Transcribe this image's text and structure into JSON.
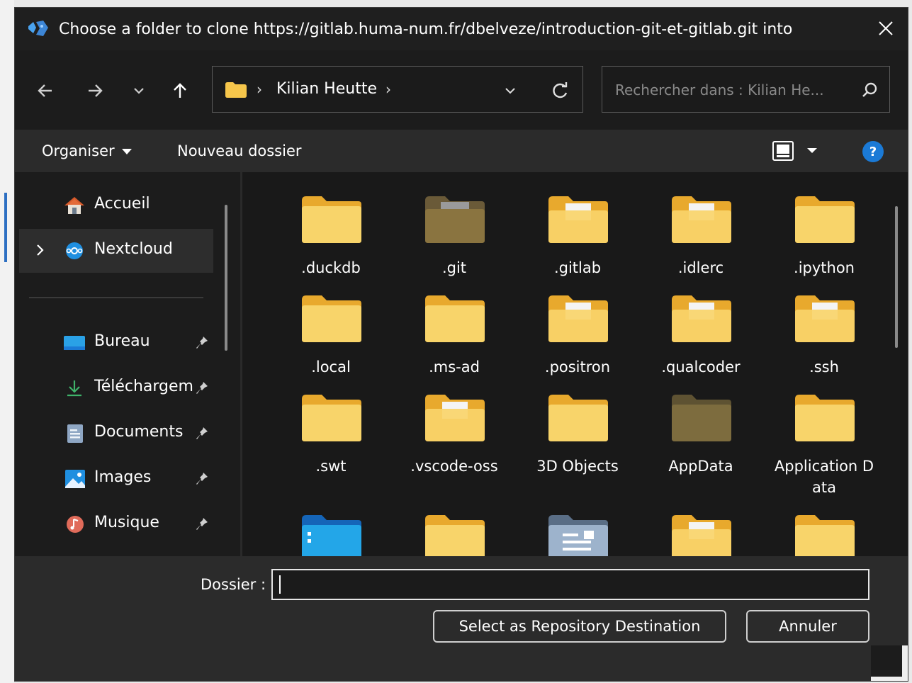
{
  "window": {
    "title": "Choose a folder to clone https://gitlab.huma-num.fr/dbelveze/introduction-git-et-gitlab.git into",
    "app_icon": "vscodium-logo-icon",
    "close_icon": "close-icon"
  },
  "nav": {
    "back_icon": "arrow-left-icon",
    "forward_icon": "arrow-right-icon",
    "recent_icon": "chevron-down-icon",
    "up_icon": "arrow-up-icon",
    "breadcrumb": [
      "Kilian Heutte"
    ],
    "refresh_icon": "refresh-icon",
    "search_placeholder": "Rechercher dans : Kilian He..."
  },
  "toolbar": {
    "organize_label": "Organiser",
    "new_folder_label": "Nouveau dossier",
    "view_icon": "view-mode-icon",
    "help_label": "?"
  },
  "sidebar": {
    "items": [
      {
        "label": "Accueil",
        "icon": "home-icon",
        "pinned": false
      },
      {
        "label": "Nextcloud",
        "icon": "nextcloud-icon",
        "pinned": false,
        "selected": true
      },
      {
        "label": "Bureau",
        "icon": "desktop-icon",
        "pinned": true
      },
      {
        "label": "Téléchargem",
        "icon": "download-icon",
        "pinned": true
      },
      {
        "label": "Documents",
        "icon": "documents-icon",
        "pinned": true
      },
      {
        "label": "Images",
        "icon": "images-icon",
        "pinned": true
      },
      {
        "label": "Musique",
        "icon": "music-icon",
        "pinned": true
      }
    ]
  },
  "files": [
    {
      "name": ".duckdb",
      "icon": "folder-icon"
    },
    {
      "name": ".git",
      "icon": "folder-hidden-icon"
    },
    {
      "name": ".gitlab",
      "icon": "folder-with-files-icon"
    },
    {
      "name": ".idlerc",
      "icon": "folder-with-files-icon"
    },
    {
      "name": ".ipython",
      "icon": "folder-icon"
    },
    {
      "name": ".local",
      "icon": "folder-icon"
    },
    {
      "name": ".ms-ad",
      "icon": "folder-icon"
    },
    {
      "name": ".positron",
      "icon": "folder-with-files-icon"
    },
    {
      "name": ".qualcoder",
      "icon": "folder-with-files-icon"
    },
    {
      "name": ".ssh",
      "icon": "folder-with-files-icon"
    },
    {
      "name": ".swt",
      "icon": "folder-icon"
    },
    {
      "name": ".vscode-oss",
      "icon": "folder-with-files-icon"
    },
    {
      "name": "3D Objects",
      "icon": "folder-icon"
    },
    {
      "name": "AppData",
      "icon": "folder-hidden-icon"
    },
    {
      "name": "Application Data",
      "icon": "folder-icon"
    },
    {
      "name": "",
      "icon": "folder-blue-icon"
    },
    {
      "name": "",
      "icon": "folder-icon"
    },
    {
      "name": "",
      "icon": "contacts-folder-icon"
    },
    {
      "name": "",
      "icon": "folder-with-files-icon"
    },
    {
      "name": "",
      "icon": "folder-icon"
    }
  ],
  "footer": {
    "folder_label": "Dossier :",
    "folder_value": "",
    "select_label": "Select as Repository Destination",
    "cancel_label": "Annuler"
  },
  "colors": {
    "background": "#1c1c1c",
    "toolbar": "#2b2b2b",
    "folder_yellow": "#f6c64b",
    "accent_blue": "#1b7ad6"
  }
}
